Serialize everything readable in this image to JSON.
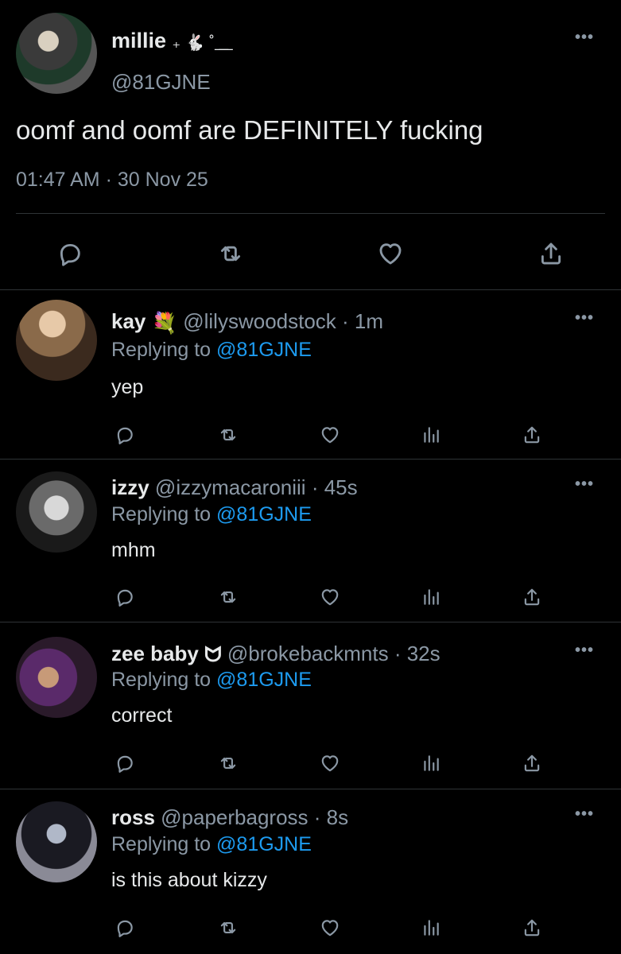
{
  "tweet": {
    "name": "millie",
    "name_deco": "₊ 🐇 ˚ ͟ ͟",
    "handle": "@81GJNE",
    "text": "oomf and oomf are DEFINITELY fucking",
    "time": "01:47 AM",
    "sep": "·",
    "date": "30 Nov 25",
    "more": "•••"
  },
  "replies": [
    {
      "name": "kay",
      "emoji": "💐",
      "handle": "@lilyswoodstock",
      "age": "· 1m",
      "replying_prefix": "Replying to",
      "replying_handle": "@81GJNE",
      "text": "yep",
      "more": "•••"
    },
    {
      "name": "izzy",
      "emoji": "",
      "handle": "@izzymacaroniii",
      "age": "· 45s",
      "replying_prefix": "Replying to",
      "replying_handle": "@81GJNE",
      "text": "mhm",
      "more": "•••"
    },
    {
      "name": "zee baby",
      "emoji": "ᗢ",
      "handle": "@brokebackmnts",
      "age": "· 32s",
      "replying_prefix": "Replying to",
      "replying_handle": "@81GJNE",
      "text": "correct",
      "more": "•••"
    },
    {
      "name": "ross",
      "emoji": "",
      "handle": "@paperbagross",
      "age": "· 8s",
      "replying_prefix": "Replying to",
      "replying_handle": "@81GJNE",
      "text": "is this about kizzy",
      "more": "•••"
    }
  ],
  "icons": {
    "reply": "reply-icon",
    "retweet": "retweet-icon",
    "like": "heart-icon",
    "views": "analytics-icon",
    "share": "share-icon"
  },
  "colors": {
    "background": "#000000",
    "text": "#e7e9ea",
    "muted": "#8b98a5",
    "link": "#1d9bf0",
    "divider": "#2f3336"
  }
}
